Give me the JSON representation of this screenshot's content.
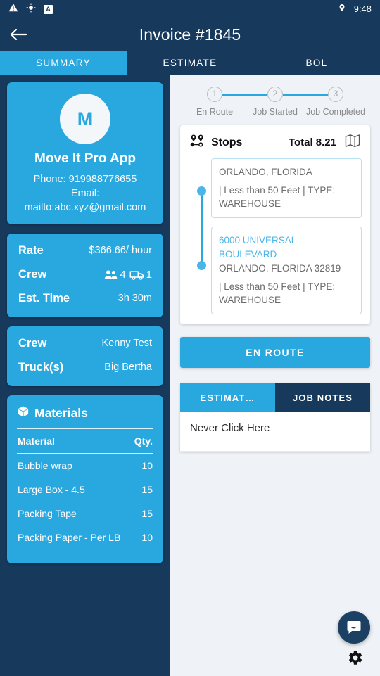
{
  "colors": {
    "navy": "#16395c",
    "accent_blue": "#29a8e0",
    "panel_bg": "#eff3f7",
    "light_blue": "#4ab5e8"
  },
  "status_bar": {
    "icons": [
      "warning-triangle-icon",
      "gps-crosshair-icon",
      "letter-a-badge-icon"
    ],
    "badge_letter": "A",
    "location_icon": "location-pin-icon",
    "time": "9:48"
  },
  "app_bar": {
    "back_icon": "back-arrow-icon",
    "title": "Invoice #1845"
  },
  "tabs": [
    {
      "label": "SUMMARY",
      "active": true
    },
    {
      "label": "ESTIMATE",
      "active": false
    },
    {
      "label": "BOL",
      "active": false
    }
  ],
  "summary": {
    "profile": {
      "avatar_initial": "M",
      "name": "Move It Pro App",
      "phone": "Phone: 919988776655",
      "email": "Email: mailto:abc.xyz@gmail.com"
    },
    "job_details": {
      "rate_label": "Rate",
      "rate_value": "$366.66/ hour",
      "crew_label": "Crew",
      "crew_people_count": "4",
      "crew_truck_count": "1",
      "est_time_label": "Est. Time",
      "est_time_value": "3h 30m"
    },
    "assignment": {
      "crew_label": "Crew",
      "crew_value": "Kenny Test",
      "truck_label": "Truck(s)",
      "truck_value": "Big Bertha"
    },
    "materials": {
      "title": "Materials",
      "icon": "package-box-icon",
      "columns": [
        "Material",
        "Qty."
      ],
      "rows": [
        {
          "name": "Bubble wrap",
          "qty": "10"
        },
        {
          "name": "Large Box - 4.5",
          "qty": "15"
        },
        {
          "name": "Packing Tape",
          "qty": "15"
        },
        {
          "name": "Packing Paper - Per LB",
          "qty": "10"
        }
      ]
    }
  },
  "job_panel": {
    "stepper": [
      {
        "number": "1",
        "label": "En Route"
      },
      {
        "number": "2",
        "label": "Job Started"
      },
      {
        "number": "3",
        "label": "Job Completed"
      }
    ],
    "stops": {
      "icon": "route-pins-icon",
      "title": "Stops",
      "total": "Total 8.21",
      "map_icon": "map-icon",
      "items": [
        {
          "address_line1": "",
          "address_line2": "ORLANDO, FLORIDA",
          "meta": " | Less than 50 Feet | TYPE: WAREHOUSE"
        },
        {
          "address_line1": "6000 UNIVERSAL BOULEVARD",
          "address_line2": "ORLANDO, FLORIDA 32819",
          "meta": " | Less than 50 Feet | TYPE: WAREHOUSE"
        }
      ]
    },
    "primary_action": "EN ROUTE",
    "notes": {
      "tabs": [
        {
          "label": "ESTIMAT…",
          "active": false
        },
        {
          "label": "JOB NOTES",
          "active": true
        }
      ],
      "content": "Never Click Here"
    }
  },
  "floating": {
    "chat_icon": "chat-bubble-icon",
    "gear_icon": "gear-icon"
  }
}
